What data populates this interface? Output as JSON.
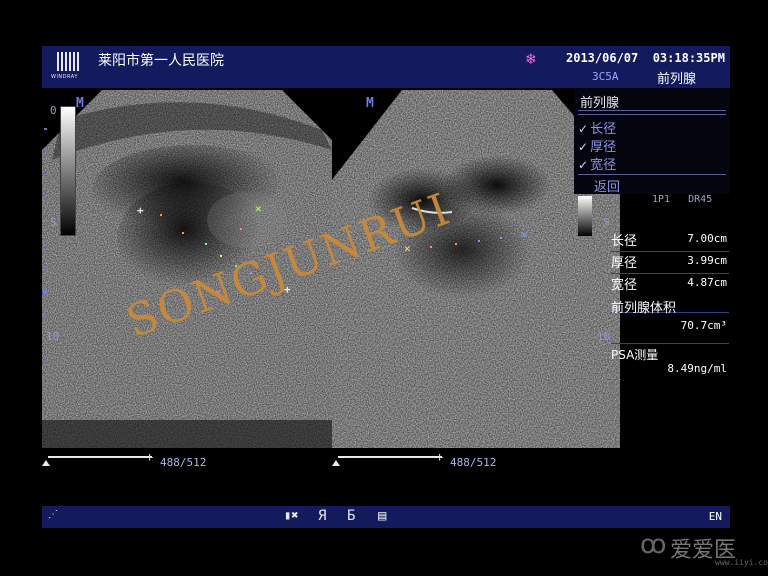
{
  "header": {
    "hospital": "莱阳市第一人民医院",
    "logo_text": "WINDRAY",
    "datetime": "2013/06/07  03:18:35PM",
    "probe": "3C5A",
    "exam": "前列腺",
    "freeze_icon": "snowflake-icon"
  },
  "left_axis": {
    "depth_labels": [
      "0",
      "5",
      "10"
    ]
  },
  "right_axis": {
    "depth_labels": [
      "5",
      "10"
    ]
  },
  "image_markers": {
    "m_left": "M",
    "m_right": "M"
  },
  "menu": {
    "title": "前列腺",
    "items": [
      {
        "label": "长径",
        "checked": true
      },
      {
        "label": "厚径",
        "checked": true
      },
      {
        "label": "宽径",
        "checked": true
      }
    ],
    "back": "返回"
  },
  "params": "1P1   DR45",
  "measurements": {
    "length_label": "长径",
    "length_value": "7.00cm",
    "thickness_label": "厚径",
    "thickness_value": "3.99cm",
    "width_label": "宽径",
    "width_value": "4.87cm",
    "volume_label": "前列腺体积",
    "volume_value": "70.7cm³",
    "psa_label": "PSA测量",
    "psa_value": "8.49ng/ml"
  },
  "cine": {
    "left_count": "488/512",
    "right_count": "488/512"
  },
  "bottom": {
    "lang": "EN"
  },
  "watermark": {
    "text": "SONGJUNRUI",
    "site": "爱爱医",
    "site_url_small": "www.iiyi.com"
  },
  "colors": {
    "bar": "#141a5e",
    "accent": "#6d7de8",
    "watermark": "#c98a3a"
  }
}
